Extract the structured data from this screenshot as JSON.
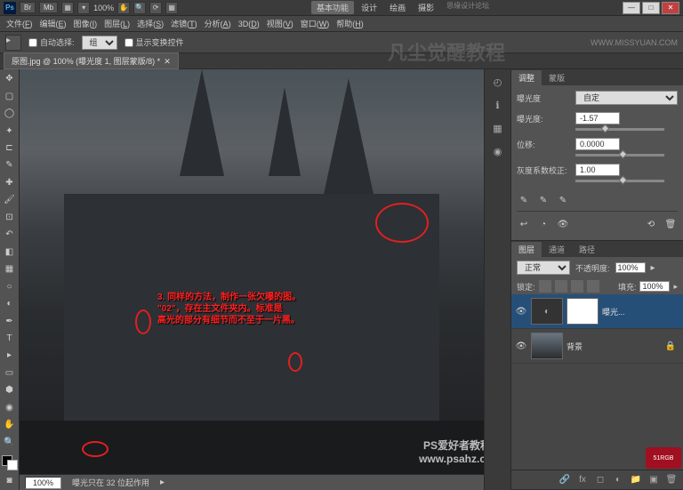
{
  "titlebar": {
    "ps": "Ps",
    "br": "Br",
    "mb": "Mb",
    "zoom": "100%",
    "workspace_tabs": [
      "基本功能",
      "设计",
      "绘画",
      "摄影"
    ],
    "active_ws": 0,
    "site_badge": "思缘设计论坛",
    "url_badge": "WWW.MISSYUAN.COM"
  },
  "menubar": {
    "items": [
      {
        "label": "文件",
        "key": "F"
      },
      {
        "label": "编辑",
        "key": "E"
      },
      {
        "label": "图像",
        "key": "I"
      },
      {
        "label": "图层",
        "key": "L"
      },
      {
        "label": "选择",
        "key": "S"
      },
      {
        "label": "滤镜",
        "key": "T"
      },
      {
        "label": "分析",
        "key": "A"
      },
      {
        "label": "3D",
        "key": "D"
      },
      {
        "label": "视图",
        "key": "V"
      },
      {
        "label": "窗口",
        "key": "W"
      },
      {
        "label": "帮助",
        "key": "H"
      }
    ]
  },
  "optionsbar": {
    "auto_select": "自动选择:",
    "auto_select_mode": "组",
    "show_transform": "显示变换控件"
  },
  "watermark_big": "凡尘觉醒教程",
  "doctab": {
    "label": "原图.jpg @ 100% (曝光度 1, 图层蒙版/8) *"
  },
  "annotation": {
    "line1": "3. 同样的方法，制作一张欠曝的图。",
    "line2": "\"02\"，存在主文件夹内。标准是",
    "line3": "高光的部分有细节而不至于一片黑。"
  },
  "statusbar": {
    "zoom": "100%",
    "info": "曝光只在 32 位起作用"
  },
  "adjustments_panel": {
    "tab1": "调整",
    "tab2": "蒙版",
    "exposure_label": "曝光度",
    "preset": "自定",
    "exposure_field_label": "曝光度:",
    "exposure_value": "-1.57",
    "offset_label": "位移:",
    "offset_value": "0.0000",
    "gamma_label": "灰度系数校正:",
    "gamma_value": "1.00"
  },
  "layers_panel": {
    "tab_layers": "图层",
    "tab_channels": "通道",
    "tab_paths": "路径",
    "blend_mode": "正常",
    "opacity_label": "不透明度:",
    "opacity_value": "100%",
    "lock_label": "锁定:",
    "fill_label": "填充:",
    "fill_value": "100%",
    "layer1_name": "曝光...",
    "layer2_name": "背景"
  },
  "bottom_watermark": "PS爱好者教程网\nwww.psahz.com"
}
